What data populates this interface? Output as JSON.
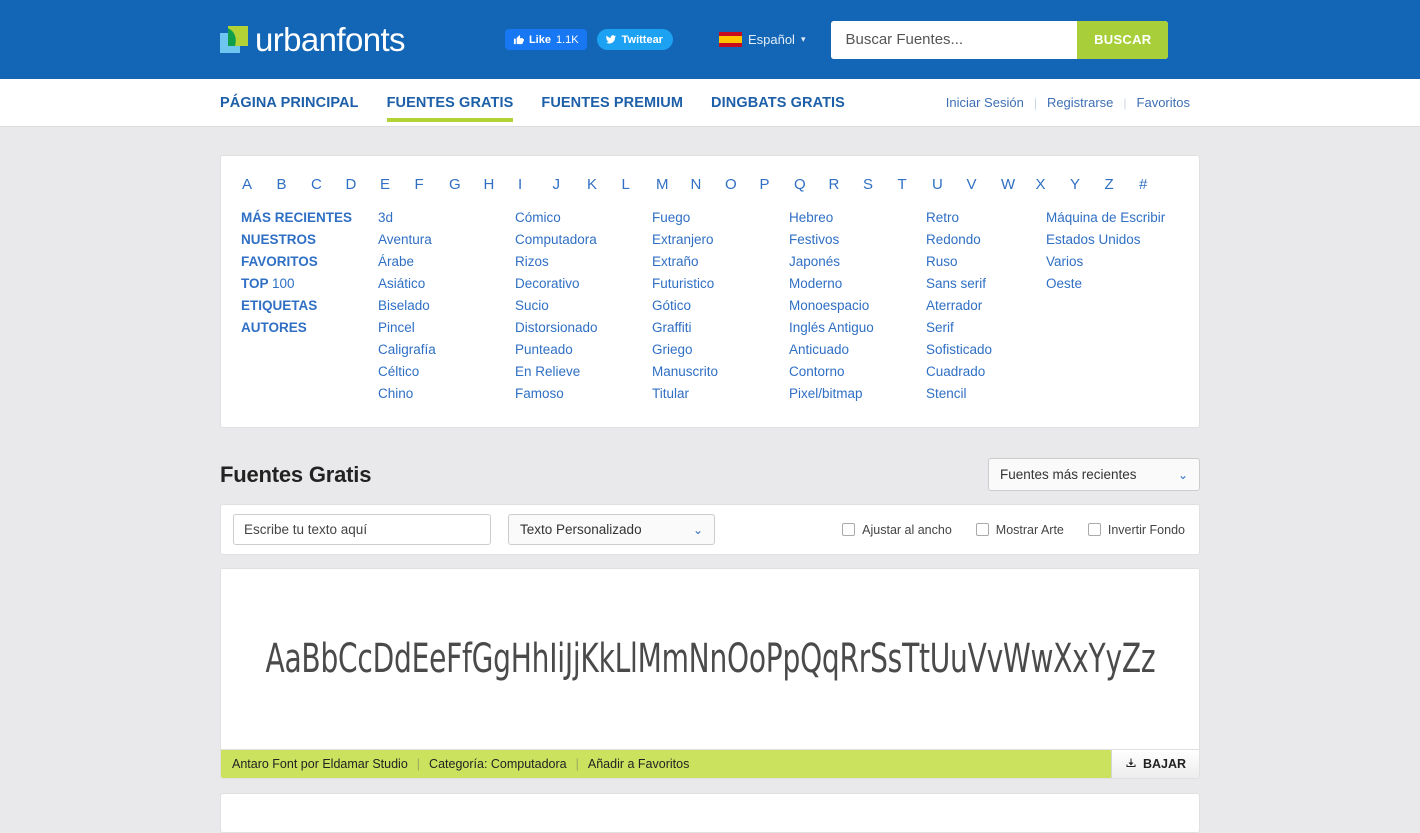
{
  "header": {
    "logo_text": "urbanfonts",
    "logo_icon": "two-squares-logo-icon",
    "facebook": {
      "icon": "thumbs-up-icon",
      "label": "Like",
      "count": "1.1K"
    },
    "twitter": {
      "icon": "twitter-bird-icon",
      "label": "Twittear"
    },
    "language": {
      "flag": "spain-flag-icon",
      "label": "Español",
      "caret": "▾"
    },
    "search": {
      "placeholder": "Buscar Fuentes...",
      "value": "",
      "button": "BUSCAR"
    }
  },
  "nav": {
    "items": [
      {
        "label": "PÁGINA PRINCIPAL",
        "active": false
      },
      {
        "label": "FUENTES GRATIS",
        "active": true
      },
      {
        "label": "FUENTES PREMIUM",
        "active": false
      },
      {
        "label": "DINGBATS GRATIS",
        "active": false
      }
    ],
    "account": [
      {
        "label": "Iniciar Sesión"
      },
      {
        "label": "Registrarse"
      },
      {
        "label": "Favoritos"
      }
    ],
    "separator": "|"
  },
  "categories": {
    "alphabet": [
      "A",
      "B",
      "C",
      "D",
      "E",
      "F",
      "G",
      "H",
      "I",
      "J",
      "K",
      "L",
      "M",
      "N",
      "O",
      "P",
      "Q",
      "R",
      "S",
      "T",
      "U",
      "V",
      "W",
      "X",
      "Y",
      "Z",
      "#"
    ],
    "columns": [
      [
        {
          "label": "MÁS RECIENTES",
          "bold": true
        },
        {
          "label": "NUESTROS",
          "bold": true
        },
        {
          "label": "FAVORITOS",
          "bold": true
        },
        {
          "label": "TOP 100",
          "bold": true,
          "split": [
            "TOP ",
            "100"
          ]
        },
        {
          "label": "ETIQUETAS",
          "bold": true
        },
        {
          "label": "AUTORES",
          "bold": true
        }
      ],
      [
        {
          "label": "3d"
        },
        {
          "label": "Aventura"
        },
        {
          "label": "Árabe"
        },
        {
          "label": "Asiático"
        },
        {
          "label": "Biselado"
        },
        {
          "label": "Pincel"
        },
        {
          "label": "Caligrafía"
        },
        {
          "label": "Céltico"
        },
        {
          "label": "Chino"
        }
      ],
      [
        {
          "label": "Cómico"
        },
        {
          "label": "Computadora"
        },
        {
          "label": "Rizos"
        },
        {
          "label": "Decorativo"
        },
        {
          "label": "Sucio"
        },
        {
          "label": "Distorsionado"
        },
        {
          "label": "Punteado"
        },
        {
          "label": "En Relieve"
        },
        {
          "label": "Famoso"
        }
      ],
      [
        {
          "label": "Fuego"
        },
        {
          "label": "Extranjero"
        },
        {
          "label": "Extraño"
        },
        {
          "label": "Futuristico"
        },
        {
          "label": "Gótico"
        },
        {
          "label": "Graffiti"
        },
        {
          "label": "Griego"
        },
        {
          "label": "Manuscrito"
        },
        {
          "label": "Titular"
        }
      ],
      [
        {
          "label": "Hebreo"
        },
        {
          "label": "Festivos"
        },
        {
          "label": "Japonés"
        },
        {
          "label": "Moderno"
        },
        {
          "label": "Monoespacio"
        },
        {
          "label": "Inglés Antiguo"
        },
        {
          "label": "Anticuado"
        },
        {
          "label": "Contorno"
        },
        {
          "label": "Pixel/bitmap"
        }
      ],
      [
        {
          "label": "Retro"
        },
        {
          "label": "Redondo"
        },
        {
          "label": "Ruso"
        },
        {
          "label": "Sans serif"
        },
        {
          "label": "Aterrador"
        },
        {
          "label": "Serif"
        },
        {
          "label": "Sofisticado"
        },
        {
          "label": "Cuadrado"
        },
        {
          "label": "Stencil"
        }
      ],
      [
        {
          "label": "Máquina de Escribir",
          "wrap": true
        },
        {
          "label": "Estados Unidos"
        },
        {
          "label": "Varios"
        },
        {
          "label": "Oeste"
        }
      ]
    ]
  },
  "section": {
    "title": "Fuentes Gratis",
    "sort": {
      "value": "Fuentes más recientes",
      "chevron": "⌄"
    }
  },
  "controls": {
    "custom_text": {
      "placeholder": "Escribe tu texto aquí",
      "value": ""
    },
    "preset": {
      "value": "Texto Personalizado",
      "chevron": "⌄"
    },
    "checkboxes": [
      {
        "label": "Ajustar al ancho",
        "checked": false
      },
      {
        "label": "Mostrar Arte",
        "checked": false
      },
      {
        "label": "Invertir Fondo",
        "checked": false
      }
    ]
  },
  "font_cards": [
    {
      "preview_text": "AaBbCcDdEeFfGgHhIiJjKkLlMmNnOoPpQqRrSsTtUuVvWwXxYyZz",
      "name": "Antaro Font por Eldamar Studio",
      "category_label": "Categoría: Computadora",
      "favorite_label": "Añadir a Favoritos",
      "separator": "|",
      "download": {
        "icon": "download-icon",
        "label": "BAJAR"
      }
    }
  ],
  "colors": {
    "header_blue": "#1366b5",
    "accent_green": "#b2d235",
    "bar_green": "#cbe25f",
    "link_blue": "#2f6fc4",
    "nav_blue": "#1d5fa8",
    "page_bg": "#e9e9eb"
  }
}
